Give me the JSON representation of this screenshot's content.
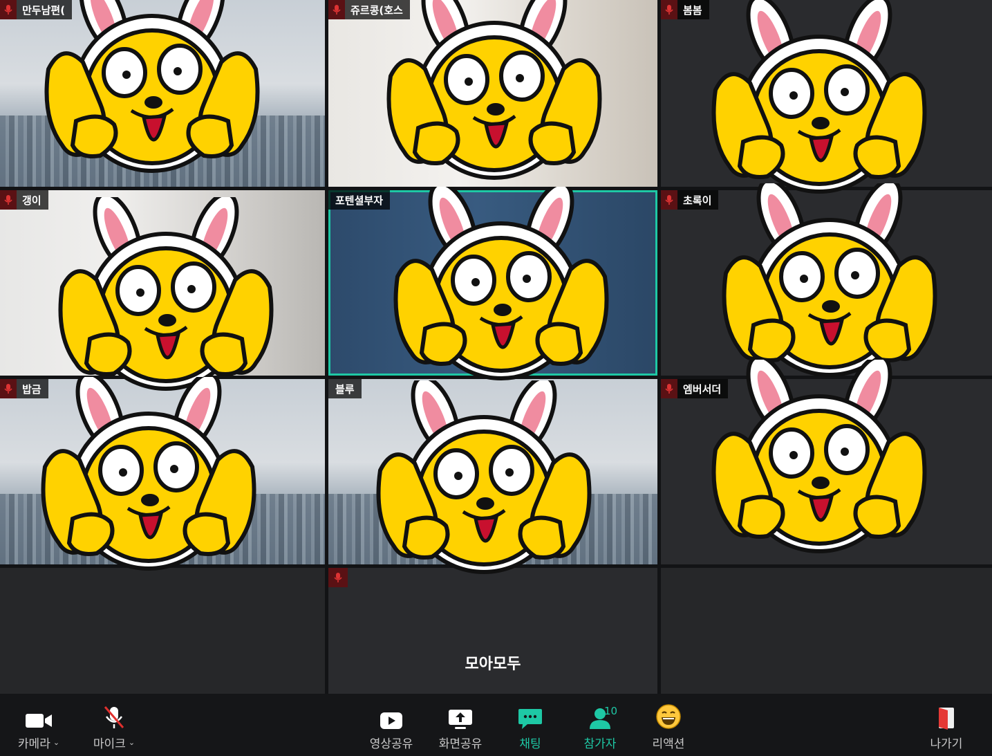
{
  "participants": [
    {
      "name": "만두남편(",
      "muted": true
    },
    {
      "name": "쥬르콩(호스",
      "muted": true
    },
    {
      "name": "봄봄",
      "muted": true
    },
    {
      "name": "갱이",
      "muted": true
    },
    {
      "name": "포텐셜부자",
      "muted": false,
      "active": true
    },
    {
      "name": "초록이",
      "muted": true
    },
    {
      "name": "밥금",
      "muted": true
    },
    {
      "name": "블루",
      "muted": false
    },
    {
      "name": "엠버서더",
      "muted": true
    }
  ],
  "bottom_tile": {
    "name": "모아모두",
    "muted": true
  },
  "toolbar": {
    "camera_label": "카메라",
    "mic_label": "마이크",
    "video_share_label": "영상공유",
    "screen_share_label": "화면공유",
    "chat_label": "채팅",
    "participants_label": "참가자",
    "participants_count": "10",
    "reaction_label": "리액션",
    "leave_label": "나가기"
  },
  "colors": {
    "accent": "#1ec8a5",
    "muted_badge": "#5a1114",
    "sticker_yellow": "#ffd200"
  }
}
